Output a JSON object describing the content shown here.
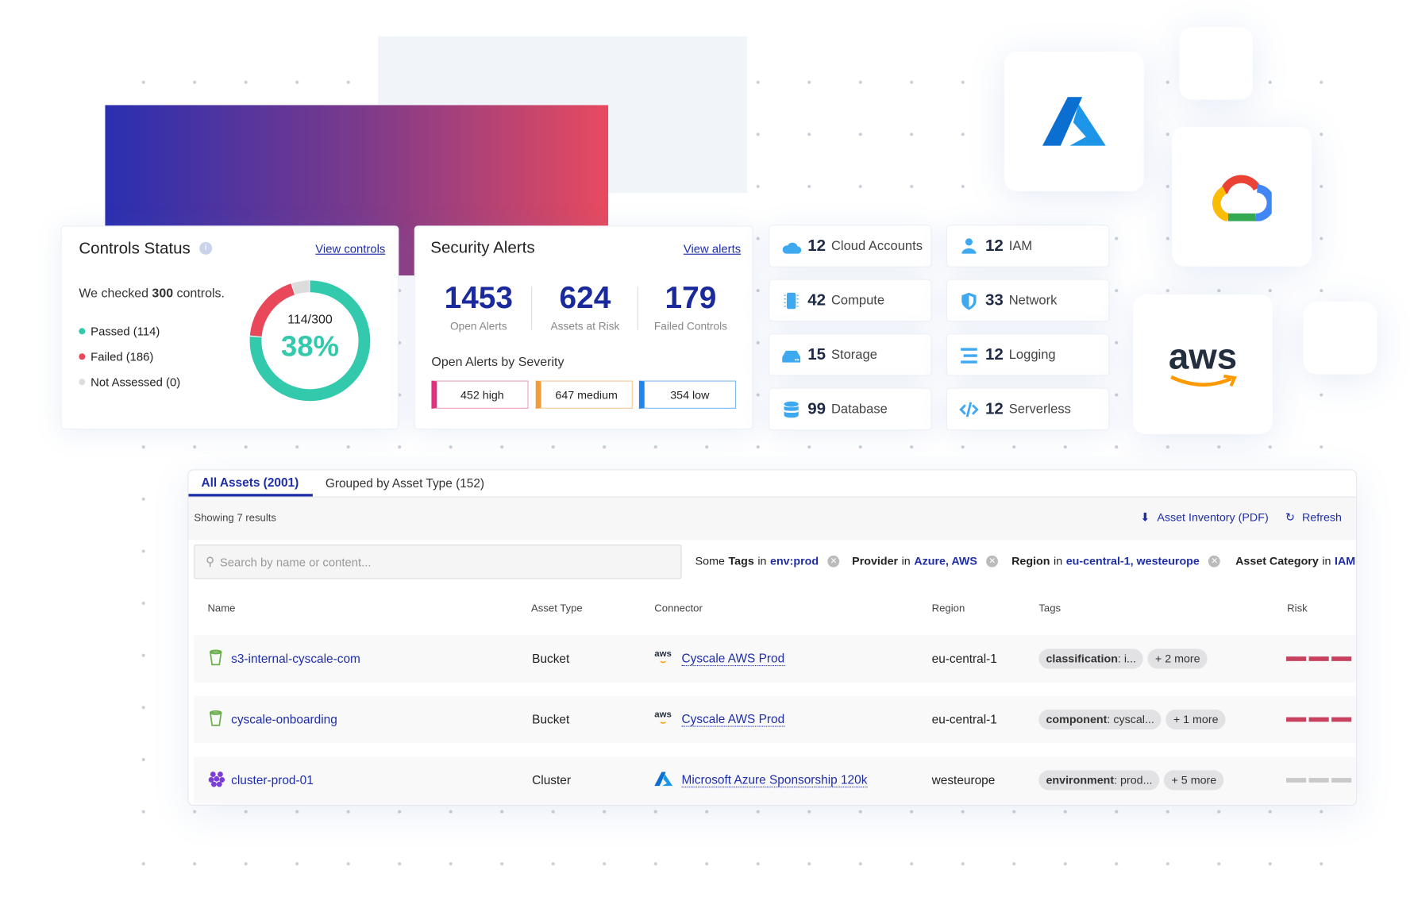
{
  "controls": {
    "title": "Controls Status",
    "link": "View controls",
    "checked_pre": "We checked ",
    "checked_num": "300",
    "checked_post": " controls.",
    "passed": "Passed (114)",
    "failed": "Failed (186)",
    "not_assessed": "Not Assessed (0)",
    "fraction": "114/300",
    "percent": "38%",
    "passed_value": 114,
    "failed_value": 186,
    "not_assessed_value": 0,
    "total": 300,
    "colors": {
      "passed": "#33c9ad",
      "failed": "#e9475a",
      "not_assessed": "#dcdcdc"
    }
  },
  "alerts": {
    "title": "Security Alerts",
    "link": "View alerts",
    "stats": [
      {
        "value": "1453",
        "label": "Open Alerts"
      },
      {
        "value": "624",
        "label": "Assets at Risk"
      },
      {
        "value": "179",
        "label": "Failed Controls"
      }
    ],
    "severity_title": "Open Alerts by Severity",
    "severity": [
      {
        "label": "452 high",
        "color": "#e0327a"
      },
      {
        "label": "647 medium",
        "color": "#f39a3a"
      },
      {
        "label": "354 low",
        "color": "#1f86f0"
      }
    ]
  },
  "resources": [
    {
      "count": "12",
      "label": "Cloud Accounts",
      "icon": "cloud-icon"
    },
    {
      "count": "12",
      "label": "IAM",
      "icon": "user-icon"
    },
    {
      "count": "42",
      "label": "Compute",
      "icon": "chip-icon"
    },
    {
      "count": "33",
      "label": "Network",
      "icon": "shield-icon"
    },
    {
      "count": "15",
      "label": "Storage",
      "icon": "storage-icon"
    },
    {
      "count": "12",
      "label": "Logging",
      "icon": "logging-icon"
    },
    {
      "count": "99",
      "label": "Database",
      "icon": "database-icon"
    },
    {
      "count": "12",
      "label": "Serverless",
      "icon": "code-icon"
    }
  ],
  "logos": {
    "aws_text": "aws"
  },
  "assets": {
    "tabs": [
      {
        "label": "All Assets (2001)",
        "active": true
      },
      {
        "label": "Grouped by Asset Type (152)"
      }
    ],
    "showing": "Showing 7 results",
    "pdf": "Asset Inventory (PDF)",
    "refresh": "Refresh",
    "search_placeholder": "Search by name or content...",
    "filters": [
      {
        "pre": "Some ",
        "key": "Tags",
        "in": " in ",
        "value": "env:prod"
      },
      {
        "pre": "",
        "key": "Provider",
        "in": " in ",
        "value": "Azure, AWS"
      },
      {
        "pre": "",
        "key": "Region",
        "in": " in ",
        "value": "eu-central-1, westeurope"
      },
      {
        "pre": "",
        "key": "Asset Category",
        "in": " in ",
        "value": "IAM,"
      }
    ],
    "columns": [
      "Name",
      "Asset Type",
      "Connector",
      "Region",
      "Tags",
      "Risk"
    ],
    "rows": [
      {
        "name": "s3-internal-cyscale-com",
        "type": "Bucket",
        "connector": "Cyscale AWS Prod",
        "provider": "aws",
        "region": "eu-central-1",
        "tag_key": "classification",
        "tag_val": ": i...",
        "more": "+ 2 more",
        "risk": "high"
      },
      {
        "name": "cyscale-onboarding",
        "type": "Bucket",
        "connector": "Cyscale AWS Prod",
        "provider": "aws",
        "region": "eu-central-1",
        "tag_key": "component",
        "tag_val": ": cyscal...",
        "more": "+ 1 more",
        "risk": "high"
      },
      {
        "name": "cluster-prod-01",
        "type": "Cluster",
        "connector": "Microsoft Azure Sponsorship 120k",
        "provider": "azure",
        "region": "westeurope",
        "tag_key": "environment",
        "tag_val": ": prod...",
        "more": "+ 5 more",
        "risk": "none"
      }
    ]
  }
}
